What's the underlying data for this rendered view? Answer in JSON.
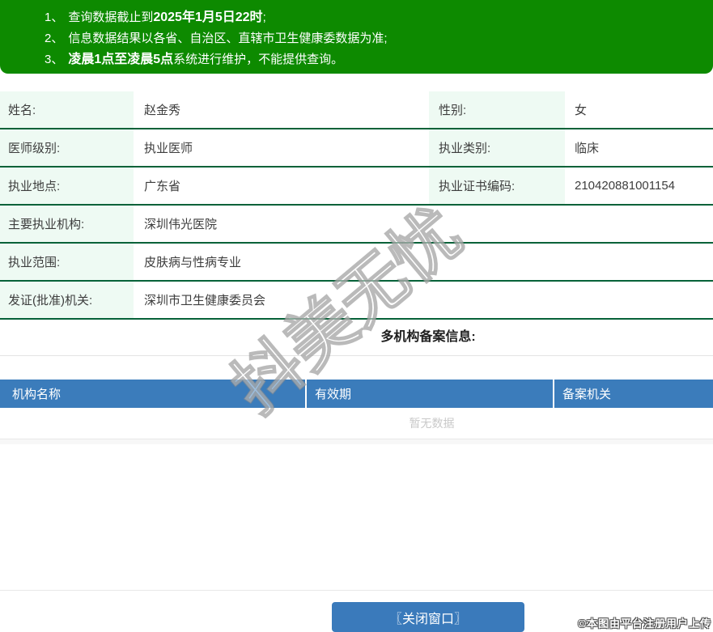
{
  "notice": {
    "items": [
      {
        "num": "1、",
        "pre": "查询数据截止到",
        "bold": "2025年1月5日22时",
        "post": ";"
      },
      {
        "num": "2、",
        "pre": "信息数据结果以各省、自治区、直辖市卫生健康委数据为准;",
        "bold": "",
        "post": ""
      },
      {
        "num": "3、",
        "pre": "",
        "bold": "凌晨1点至凌晨5点",
        "post": "系统进行维护，不能提供查询。"
      }
    ]
  },
  "profile": {
    "rows": [
      {
        "label": "姓名:",
        "value": "赵金秀",
        "label2": "性别:",
        "value2": "女"
      },
      {
        "label": "医师级别:",
        "value": "执业医师",
        "label2": "执业类别:",
        "value2": "临床"
      },
      {
        "label": "执业地点:",
        "value": "广东省",
        "label2": "执业证书编码:",
        "value2": "210420881001154"
      },
      {
        "label": "主要执业机构:",
        "value": "深圳伟光医院"
      },
      {
        "label": "执业范围:",
        "value": "皮肤病与性病专业"
      },
      {
        "label": "发证(批准)机关:",
        "value": "深圳市卫生健康委员会"
      }
    ]
  },
  "filing": {
    "title": "多机构备案信息:",
    "columns": [
      "机构名称",
      "有效期",
      "备案机关"
    ],
    "empty_text": "暂无数据"
  },
  "actions": {
    "close_button": "〖关闭窗口〗"
  },
  "watermarks": {
    "diagonal": "抖美无忧",
    "credit": "©本图由平台注册用户上传"
  },
  "colors": {
    "notice_green": "#0d8a00",
    "row_border_green": "#076239",
    "label_bg_mint": "#eefaf3",
    "table_header_blue": "#3b7cbb",
    "button_blue": "#3a7abb",
    "empty_text_gray": "#c9c9c9"
  }
}
